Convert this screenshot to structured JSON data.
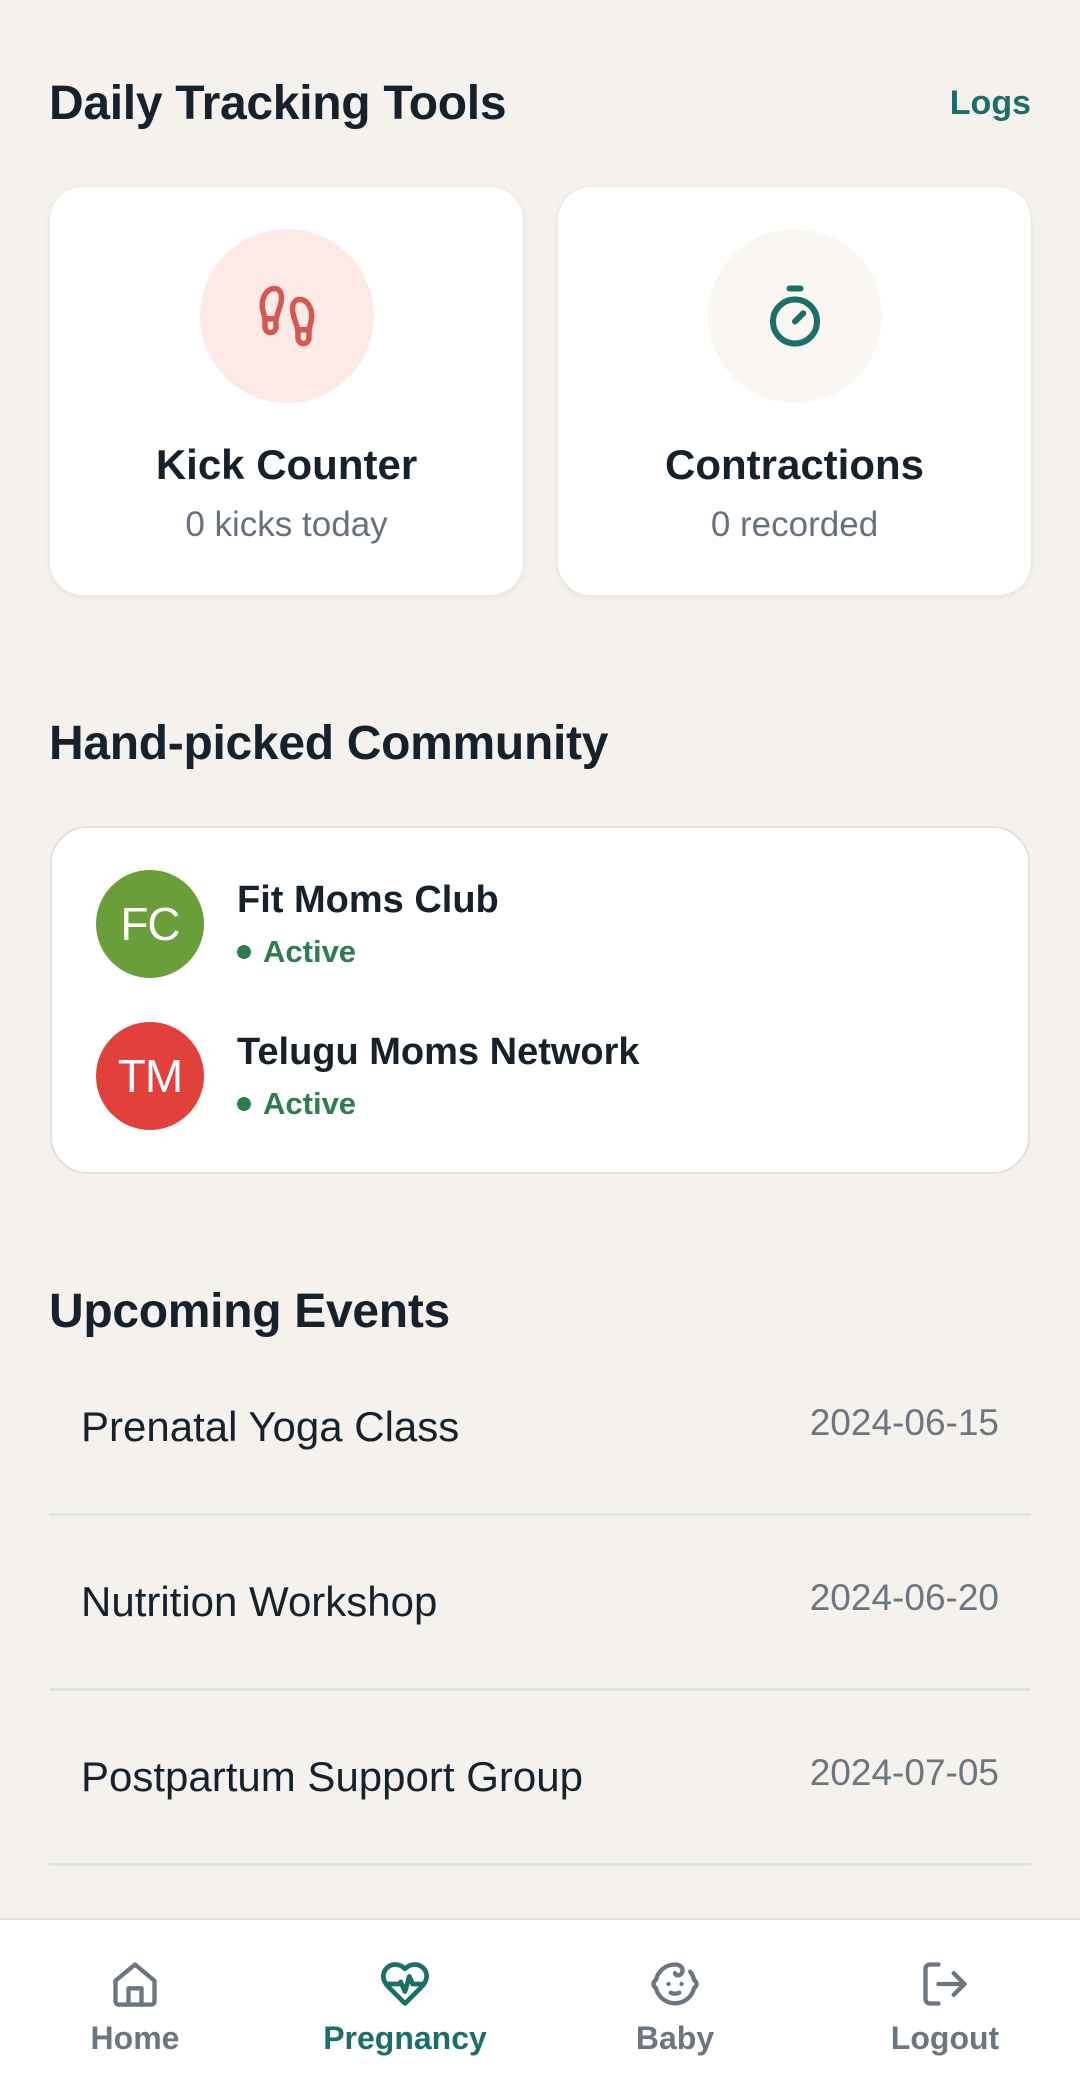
{
  "tracking": {
    "title": "Daily Tracking Tools",
    "logs_label": "Logs",
    "cards": [
      {
        "title": "Kick Counter",
        "subtitle": "0 kicks today",
        "icon": "footprints-icon"
      },
      {
        "title": "Contractions",
        "subtitle": "0 recorded",
        "icon": "stopwatch-icon"
      }
    ]
  },
  "community": {
    "title": "Hand-picked Community",
    "groups": [
      {
        "initials": "FC",
        "name": "Fit Moms Club",
        "status": "Active",
        "color": "#6a9e3a"
      },
      {
        "initials": "TM",
        "name": "Telugu Moms Network",
        "status": "Active",
        "color": "#e2403a"
      }
    ]
  },
  "events": {
    "title": "Upcoming Events",
    "items": [
      {
        "name": "Prenatal Yoga Class",
        "date": "2024-06-15"
      },
      {
        "name": "Nutrition Workshop",
        "date": "2024-06-20"
      },
      {
        "name": "Postpartum Support Group",
        "date": "2024-07-05"
      }
    ]
  },
  "nav": {
    "items": [
      {
        "label": "Home",
        "icon": "home-icon",
        "active": false
      },
      {
        "label": "Pregnancy",
        "icon": "heart-pulse-icon",
        "active": true
      },
      {
        "label": "Baby",
        "icon": "baby-face-icon",
        "active": false
      },
      {
        "label": "Logout",
        "icon": "logout-icon",
        "active": false
      }
    ]
  },
  "colors": {
    "accent": "#1b6f68",
    "background": "#f5f2ee",
    "kick_icon": "#d9534f",
    "status_active": "#2e7d4f"
  }
}
